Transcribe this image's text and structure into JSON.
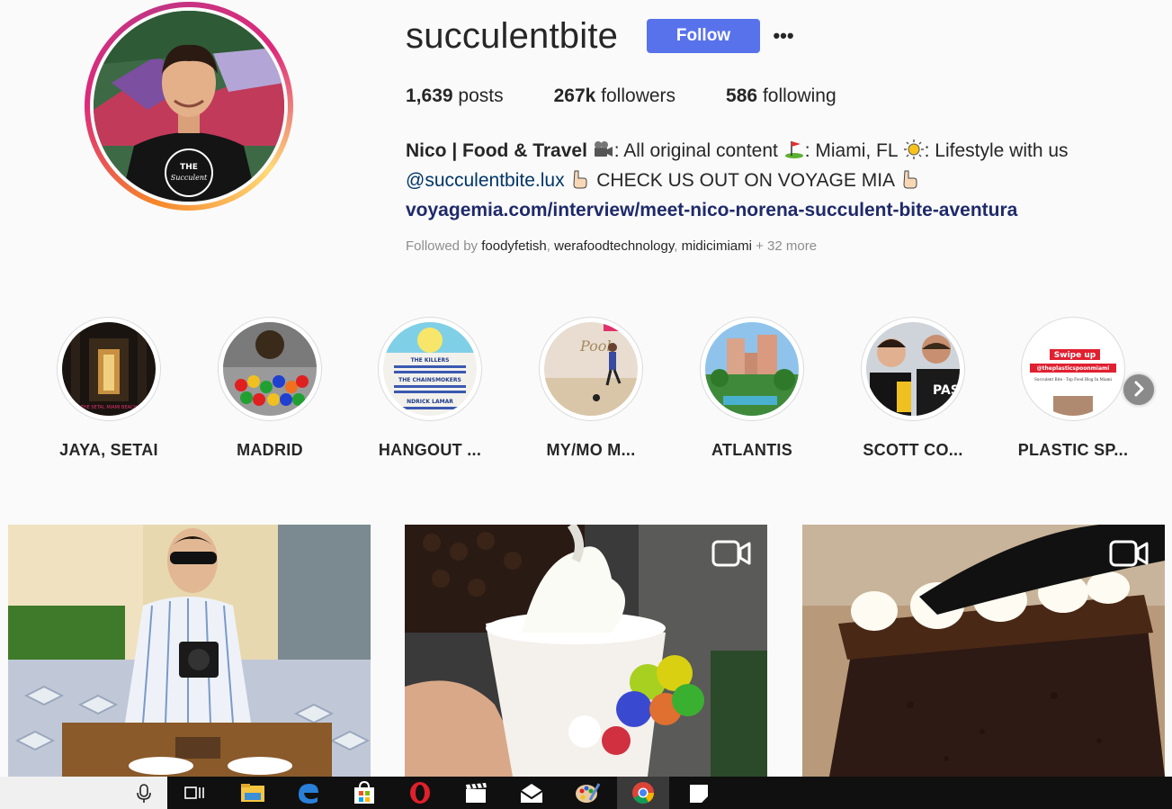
{
  "profile": {
    "username": "succulentbite",
    "follow_label": "Follow",
    "more_label": "•••",
    "posts_count": "1,639",
    "posts_label": "posts",
    "followers_count": "267k",
    "followers_label": "followers",
    "following_count": "586",
    "following_label": "following"
  },
  "bio": {
    "name": "Nico | Food & Travel",
    "part1": ": All original content ",
    "part2": ": Miami, FL ",
    "part3": ": Lifestyle with us",
    "mention": "@succulentbite.lux",
    "cta": " CHECK US OUT ON VOYAGE MIA ",
    "link": "voyagemia.com/interview/meet-nico-norena-succulent-bite-aventura"
  },
  "followed_by": {
    "prefix": "Followed by ",
    "users": [
      "foodyfetish",
      "werafoodtechnology",
      "midicimiami"
    ],
    "more": " + 32 more"
  },
  "highlights": [
    {
      "label": "JAYA, SETAI"
    },
    {
      "label": "MADRID"
    },
    {
      "label": "HANGOUT ..."
    },
    {
      "label": "MY/MO M..."
    },
    {
      "label": "ATLANTIS"
    },
    {
      "label": "SCOTT CO..."
    },
    {
      "label": "PLASTIC SP..."
    }
  ],
  "highlight_thumb_text": {
    "setai": "THE SETAI, MIAMI BEACH",
    "festival_1": "THE KILLERS",
    "festival_2": "THE CHAINSMOKERS",
    "festival_3": "NDRICK LAMAR",
    "pool": "Pool",
    "plastic_swipe": "Swipe up",
    "plastic_mention": "@theplasticspoonmiami",
    "plastic_title": "Succulent Bite - Top Food Blog In Miami",
    "scott": "PASTA"
  },
  "posts": [
    {
      "type": "photo",
      "subject": "man with camera at table"
    },
    {
      "type": "video",
      "subject": "frozen yogurt with candies"
    },
    {
      "type": "video",
      "subject": "chocolate cake with cream"
    }
  ],
  "taskbar": {
    "icons": [
      "microphone-icon",
      "task-view-icon",
      "file-explorer-icon",
      "edge-icon",
      "store-icon",
      "opera-icon",
      "clapperboard-icon",
      "mail-icon",
      "paint-icon",
      "chrome-icon",
      "sticky-notes-icon"
    ]
  },
  "colors": {
    "follow_button": "#5872ec",
    "mention": "#003569",
    "link": "#1f2a6b",
    "muted": "#8e8e8e",
    "taskbar": "#101010"
  }
}
